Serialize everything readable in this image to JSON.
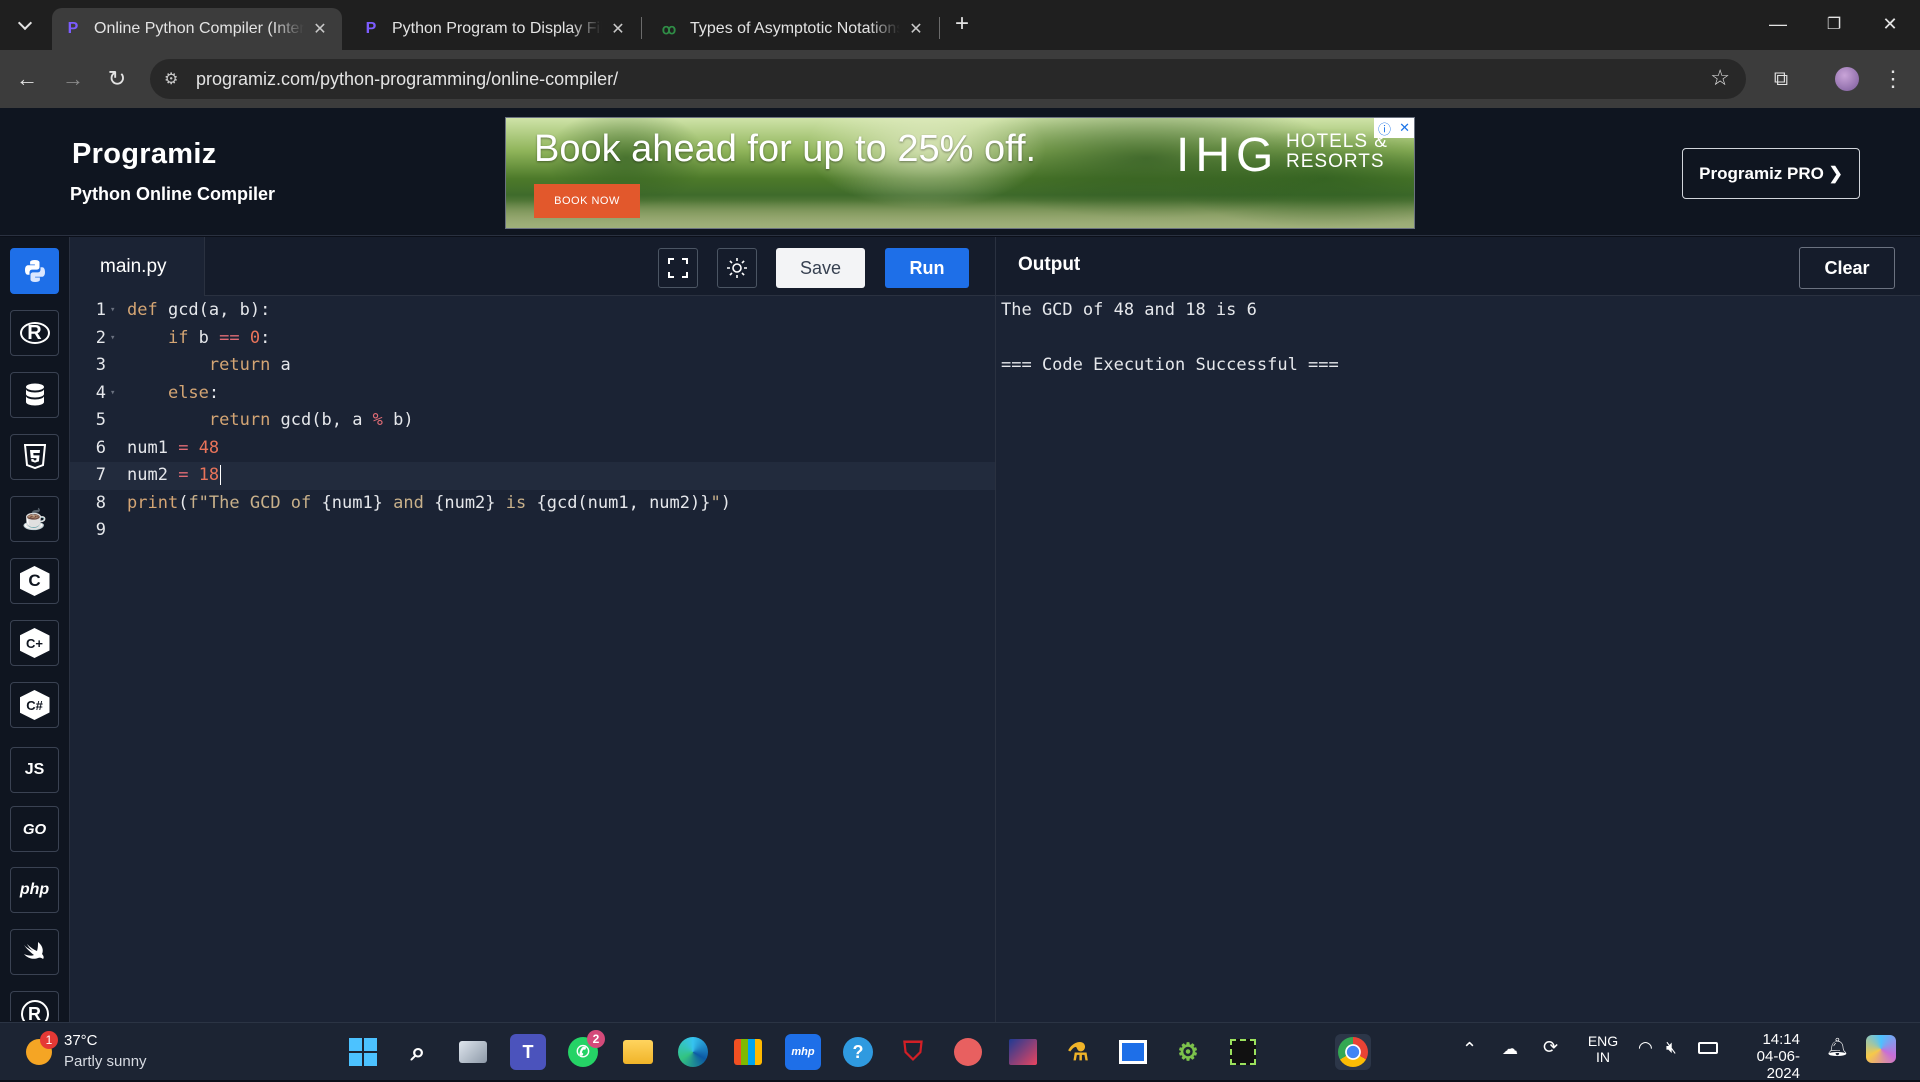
{
  "browser": {
    "tabs": [
      {
        "title": "Online Python Compiler (Interp",
        "active": true
      },
      {
        "title": "Python Program to Display Fibo",
        "active": false
      },
      {
        "title": "Types of Asymptotic Notations",
        "active": false
      }
    ],
    "url": "programiz.com/python-programming/online-compiler/",
    "icons": {
      "back": "arrow-left",
      "forward": "arrow-right",
      "reload": "reload",
      "bookmark": "star",
      "extensions": "puzzle",
      "menu": "kebab"
    }
  },
  "site": {
    "logo": "Programiz",
    "subtitle": "Python Online Compiler",
    "pro_button": "Programiz PRO ❯",
    "ad": {
      "headline": "Book ahead for up to 25% off.",
      "cta": "BOOK NOW",
      "brand": "IHG",
      "brand_line1": "HOTELS &",
      "brand_line2": "RESORTS"
    }
  },
  "sidebar": {
    "languages": [
      {
        "id": "python",
        "label": "",
        "icon": "python-icon",
        "active": true
      },
      {
        "id": "r",
        "label": "R",
        "icon": "r-icon",
        "active": false
      },
      {
        "id": "sql",
        "label": "",
        "icon": "database-icon",
        "active": false
      },
      {
        "id": "html",
        "label": "5",
        "icon": "html5-icon",
        "active": false
      },
      {
        "id": "java",
        "label": "☕",
        "icon": "java-icon",
        "active": false
      },
      {
        "id": "c",
        "label": "C",
        "icon": "c-icon",
        "active": false
      },
      {
        "id": "cpp",
        "label": "C+",
        "icon": "cpp-icon",
        "active": false
      },
      {
        "id": "csharp",
        "label": "C#",
        "icon": "csharp-icon",
        "active": false
      },
      {
        "id": "js",
        "label": "JS",
        "icon": "javascript-icon",
        "active": false
      },
      {
        "id": "go",
        "label": "GO",
        "icon": "go-icon",
        "active": false
      },
      {
        "id": "php",
        "label": "php",
        "icon": "php-icon",
        "active": false
      },
      {
        "id": "swift",
        "label": "",
        "icon": "swift-icon",
        "active": false
      },
      {
        "id": "rust",
        "label": "R",
        "icon": "rust-icon",
        "active": false
      }
    ]
  },
  "editor": {
    "filename": "main.py",
    "save_label": "Save",
    "run_label": "Run",
    "lines": [
      {
        "n": "1",
        "text": "def gcd(a, b):"
      },
      {
        "n": "2",
        "text": "    if b == 0:"
      },
      {
        "n": "3",
        "text": "        return a"
      },
      {
        "n": "4",
        "text": "    else:"
      },
      {
        "n": "5",
        "text": "        return gcd(b, a % b)"
      },
      {
        "n": "6",
        "text": "num1 = 48"
      },
      {
        "n": "7",
        "text": "num2 = 18"
      },
      {
        "n": "8",
        "text": "print(f\"The GCD of {num1} and {num2} is {gcd(num1, num2)}\")"
      },
      {
        "n": "9",
        "text": ""
      }
    ]
  },
  "output": {
    "title": "Output",
    "clear_label": "Clear",
    "text": "The GCD of 48 and 18 is 6\n\n=== Code Execution Successful ==="
  },
  "taskbar": {
    "weather_temp": "37°C",
    "weather_desc": "Partly sunny",
    "weather_badge": "1",
    "whatsapp_badge": "2",
    "lang_line1": "ENG",
    "lang_line2": "IN",
    "time": "14:14",
    "date": "04-06-2024"
  },
  "colors": {
    "accent": "#1e6fe8",
    "editor_bg": "#1b2334",
    "header_bg": "#0f1520"
  }
}
